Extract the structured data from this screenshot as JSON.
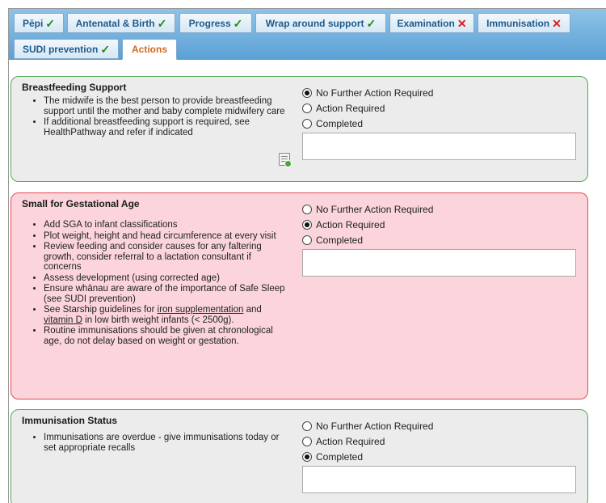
{
  "tabs": [
    {
      "label": "Pēpi",
      "status": "✓",
      "kind": "ok"
    },
    {
      "label": "Antenatal & Birth",
      "status": "✓",
      "kind": "ok"
    },
    {
      "label": "Progress",
      "status": "✓",
      "kind": "ok"
    },
    {
      "label": "Wrap around support",
      "status": "✓",
      "kind": "ok"
    },
    {
      "label": "Examination",
      "status": "✕",
      "kind": "bad"
    },
    {
      "label": "Immunisation",
      "status": "✕",
      "kind": "bad"
    },
    {
      "label": "SUDI prevention",
      "status": "✓",
      "kind": "ok"
    },
    {
      "label": "Actions",
      "status": "",
      "kind": "active"
    }
  ],
  "options": {
    "no_action": "No Further Action Required",
    "action_required": "Action Required",
    "completed": "Completed"
  },
  "panels": {
    "breastfeeding": {
      "title": "Breastfeeding Support",
      "selected": "no_action",
      "notes": "",
      "bullets": [
        "The midwife is the best person to provide breastfeeding support until the mother and baby complete midwifery care",
        "If additional breastfeeding support is required, see HealthPathway and refer if indicated"
      ]
    },
    "sga": {
      "title": "Small for Gestational Age",
      "selected": "action_required",
      "notes": "",
      "bullets": {
        "b1": "Add SGA to infant classifications",
        "b2": "Plot weight, height and head circumference at every visit",
        "b3": "Review feeding and consider causes for any faltering growth, consider referral to a lactation consultant if concerns",
        "b4": "Assess development (using corrected age)",
        "b5": "Ensure whānau are aware of the importance of Safe Sleep (see SUDI prevention)",
        "b6_pre": "See Starship guidelines for ",
        "b6_link1": "iron supplementation",
        "b6_mid": " and ",
        "b6_link2": "vitamin D",
        "b6_post": " in low birth weight infants (< 2500g).",
        "b7": "Routine immunisations should be given at chronological age, do not delay based on weight or gestation."
      }
    },
    "immunisation": {
      "title": "Immunisation Status",
      "selected": "completed",
      "notes": "",
      "bullets": [
        "Immunisations are overdue - give immunisations today or set appropriate recalls"
      ]
    }
  }
}
